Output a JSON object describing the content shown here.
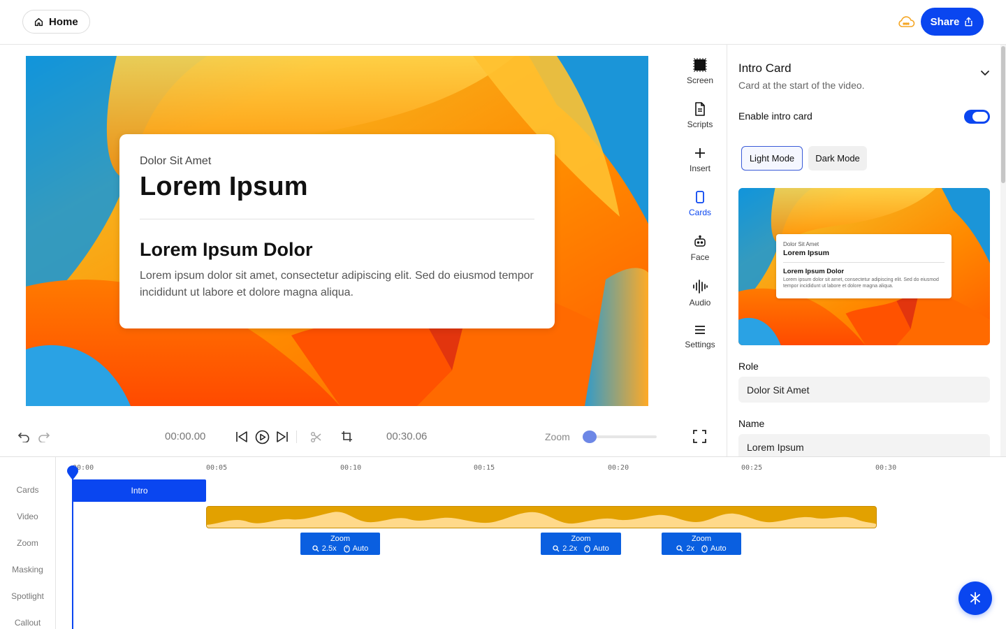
{
  "header": {
    "home_label": "Home",
    "share_label": "Share"
  },
  "colors": {
    "accent": "#0a46f0",
    "track_video": "#e2a100",
    "track_zoom": "#0a5fe0",
    "cloud": "#f5a623"
  },
  "preview_card": {
    "role": "Dolor Sit Amet",
    "name": "Lorem Ipsum",
    "heading": "Lorem Ipsum Dolor",
    "body": "Lorem ipsum dolor sit amet, consectetur adipiscing elit. Sed do eiusmod tempor incididunt ut labore et dolore magna aliqua."
  },
  "tools": [
    {
      "label": "Screen",
      "icon": "screen-icon"
    },
    {
      "label": "Scripts",
      "icon": "document-icon"
    },
    {
      "label": "Insert",
      "icon": "plus-icon"
    },
    {
      "label": "Cards",
      "icon": "card-icon",
      "active": true
    },
    {
      "label": "Face",
      "icon": "robot-icon"
    },
    {
      "label": "Audio",
      "icon": "waveform-icon"
    },
    {
      "label": "Settings",
      "icon": "menu-icon"
    }
  ],
  "controls": {
    "current_time": "00:00.00",
    "total_time": "00:30.06",
    "zoom_label": "Zoom",
    "zoom_level": 0.05
  },
  "panel": {
    "title": "Intro Card",
    "subtitle": "Card at the start of the video.",
    "enable_label": "Enable intro card",
    "enabled": true,
    "mode_light": "Light Mode",
    "mode_dark": "Dark Mode",
    "selected_mode": "Light Mode",
    "role_label": "Role",
    "role_value": "Dolor Sit Amet",
    "name_label": "Name",
    "name_value": "Lorem Ipsum"
  },
  "timeline": {
    "tracks": [
      "Cards",
      "Video",
      "Zoom",
      "Masking",
      "Spotlight",
      "Callout"
    ],
    "ticks": [
      "00:00",
      "00:05",
      "00:10",
      "00:15",
      "00:20",
      "00:25",
      "00:30"
    ],
    "intro_clip": "Intro",
    "zoom_clips": [
      {
        "title": "Zoom",
        "scale": "2.5x",
        "mode": "Auto"
      },
      {
        "title": "Zoom",
        "scale": "2.2x",
        "mode": "Auto"
      },
      {
        "title": "Zoom",
        "scale": "2x",
        "mode": "Auto"
      }
    ]
  }
}
